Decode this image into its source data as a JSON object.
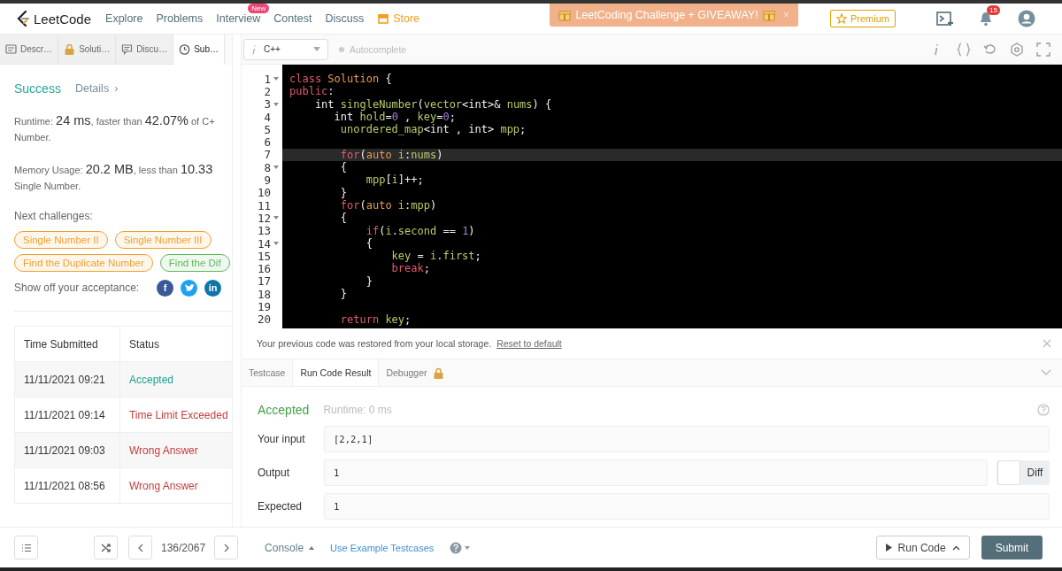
{
  "nav": {
    "logo": "LeetCode",
    "items": [
      {
        "label": "Explore",
        "kind": "link"
      },
      {
        "label": "Problems",
        "kind": "link"
      },
      {
        "label": "Interview",
        "kind": "link",
        "badge": "New"
      },
      {
        "label": "Contest",
        "kind": "link"
      },
      {
        "label": "Discuss",
        "kind": "link"
      },
      {
        "label": "Store",
        "kind": "store"
      }
    ],
    "banner": {
      "text": "LeetCoding Challenge + GIVEAWAY!",
      "close": "×"
    },
    "premium": "Premium",
    "notifications": "15"
  },
  "left_tabs": [
    {
      "label": "Descr…",
      "kind": "description",
      "selected": false
    },
    {
      "label": "Soluti…",
      "kind": "lock",
      "selected": false
    },
    {
      "label": "Discu…",
      "kind": "comment",
      "selected": false
    },
    {
      "label": "Sub…",
      "kind": "clock",
      "selected": true
    }
  ],
  "result": {
    "status": "Success",
    "details": "Details",
    "details_chevron": "›",
    "runtime": [
      [
        {
          "text": "Runtime: ",
          "kind": "label"
        },
        {
          "text": "24 ms",
          "kind": "big"
        },
        {
          "text": ", faster than ",
          "kind": "label"
        },
        {
          "text": "42.07%",
          "kind": "big"
        },
        {
          "text": " of C+",
          "kind": "label"
        }
      ],
      [
        {
          "text": "Number.",
          "kind": "label"
        }
      ]
    ],
    "memory": [
      [
        {
          "text": "Memory Usage: ",
          "kind": "label"
        },
        {
          "text": "20.2 MB",
          "kind": "big"
        },
        {
          "text": ", less than ",
          "kind": "label"
        },
        {
          "text": "10.33",
          "kind": "big"
        }
      ],
      [
        {
          "text": "Single Number.",
          "kind": "label"
        }
      ]
    ],
    "next_label": "Next challenges:",
    "challenges": [
      {
        "label": "Single Number II",
        "color": "#f0a030"
      },
      {
        "label": "Single Number III",
        "color": "#f0a030"
      },
      {
        "label": "Find the Duplicate Number",
        "color": "#f0a030"
      },
      {
        "label": "Find the Dif",
        "color": "#5cb85c"
      }
    ],
    "share_label": "Show off your acceptance:",
    "share": [
      {
        "kind": "facebook",
        "glyph": "f"
      },
      {
        "kind": "twitter"
      },
      {
        "kind": "linkedin",
        "glyph": "in"
      }
    ]
  },
  "submissions": {
    "columns": [
      "Time Submitted",
      "Status"
    ],
    "rows": [
      {
        "time": "11/11/2021 09:21",
        "status": "Accepted",
        "color": "#1a9f8f"
      },
      {
        "time": "11/11/2021 09:14",
        "status": "Time Limit Exceeded",
        "color": "#c43b3b"
      },
      {
        "time": "11/11/2021 09:03",
        "status": "Wrong Answer",
        "color": "#c43b3b"
      },
      {
        "time": "11/11/2021 08:56",
        "status": "Wrong Answer",
        "color": "#c43b3b"
      }
    ]
  },
  "editor": {
    "language": "C++",
    "autocomplete": {
      "label": "Autocomplete",
      "on": false
    },
    "lines": [
      {
        "number": "1",
        "fold": true,
        "active": false,
        "tokens": [
          {
            "text": "class ",
            "kind": "kw"
          },
          {
            "text": "Solution",
            "kind": "cls"
          },
          {
            "text": " {",
            "kind": "p"
          }
        ]
      },
      {
        "number": "2",
        "fold": false,
        "active": false,
        "tokens": [
          {
            "text": "public",
            "kind": "kw"
          },
          {
            "text": ":",
            "kind": "p"
          }
        ]
      },
      {
        "number": "3",
        "fold": true,
        "active": false,
        "tokens": [
          {
            "text": "    int ",
            "kind": "p"
          },
          {
            "text": "singleNumber",
            "kind": "fn"
          },
          {
            "text": "(",
            "kind": "p"
          },
          {
            "text": "vector",
            "kind": "fn"
          },
          {
            "text": "<int>& ",
            "kind": "p"
          },
          {
            "text": "nums",
            "kind": "fn"
          },
          {
            "text": ") {",
            "kind": "p"
          }
        ]
      },
      {
        "number": "4",
        "fold": false,
        "active": false,
        "tokens": [
          {
            "text": "       int ",
            "kind": "p"
          },
          {
            "text": "hold",
            "kind": "fn"
          },
          {
            "text": "=",
            "kind": "p"
          },
          {
            "text": "0",
            "kind": "num"
          },
          {
            "text": " , ",
            "kind": "p"
          },
          {
            "text": "key",
            "kind": "fn"
          },
          {
            "text": "=",
            "kind": "p"
          },
          {
            "text": "0",
            "kind": "num"
          },
          {
            "text": ";",
            "kind": "p"
          }
        ]
      },
      {
        "number": "5",
        "fold": false,
        "active": false,
        "tokens": [
          {
            "text": "        unordered_map",
            "kind": "fn"
          },
          {
            "text": "<int , int> ",
            "kind": "p"
          },
          {
            "text": "mpp",
            "kind": "fn"
          },
          {
            "text": ";",
            "kind": "p"
          }
        ]
      },
      {
        "number": "6",
        "fold": false,
        "active": false
      },
      {
        "number": "7",
        "fold": false,
        "active": true,
        "tokens": [
          {
            "text": "        for",
            "kind": "kw"
          },
          {
            "text": "(",
            "kind": "p"
          },
          {
            "text": "auto ",
            "kind": "cls"
          },
          {
            "text": "i",
            "kind": "fn"
          },
          {
            "text": ":",
            "kind": "p"
          },
          {
            "text": "nums",
            "kind": "fn"
          },
          {
            "text": ")",
            "kind": "p"
          }
        ]
      },
      {
        "number": "8",
        "fold": true,
        "active": false,
        "tokens": [
          {
            "text": "        {",
            "kind": "p"
          }
        ]
      },
      {
        "number": "9",
        "fold": false,
        "active": false,
        "tokens": [
          {
            "text": "            mpp",
            "kind": "fn"
          },
          {
            "text": "[",
            "kind": "p"
          },
          {
            "text": "i",
            "kind": "fn"
          },
          {
            "text": "]++;",
            "kind": "p"
          }
        ]
      },
      {
        "number": "10",
        "fold": false,
        "active": false,
        "tokens": [
          {
            "text": "        }",
            "kind": "p"
          }
        ]
      },
      {
        "number": "11",
        "fold": false,
        "active": false,
        "tokens": [
          {
            "text": "        for",
            "kind": "kw"
          },
          {
            "text": "(",
            "kind": "p"
          },
          {
            "text": "auto ",
            "kind": "cls"
          },
          {
            "text": "i",
            "kind": "fn"
          },
          {
            "text": ":",
            "kind": "p"
          },
          {
            "text": "mpp",
            "kind": "fn"
          },
          {
            "text": ")",
            "kind": "p"
          }
        ]
      },
      {
        "number": "12",
        "fold": true,
        "active": false,
        "tokens": [
          {
            "text": "        {",
            "kind": "p"
          }
        ]
      },
      {
        "number": "13",
        "fold": false,
        "active": false,
        "tokens": [
          {
            "text": "            if",
            "kind": "kw"
          },
          {
            "text": "(",
            "kind": "p"
          },
          {
            "text": "i",
            "kind": "fn"
          },
          {
            "text": ".",
            "kind": "p"
          },
          {
            "text": "second",
            "kind": "fn"
          },
          {
            "text": " == ",
            "kind": "p"
          },
          {
            "text": "1",
            "kind": "num"
          },
          {
            "text": ")",
            "kind": "p"
          }
        ]
      },
      {
        "number": "14",
        "fold": true,
        "active": false,
        "tokens": [
          {
            "text": "            {",
            "kind": "p"
          }
        ]
      },
      {
        "number": "15",
        "fold": false,
        "active": false,
        "tokens": [
          {
            "text": "                key",
            "kind": "fn"
          },
          {
            "text": " = ",
            "kind": "p"
          },
          {
            "text": "i",
            "kind": "fn"
          },
          {
            "text": ".",
            "kind": "p"
          },
          {
            "text": "first",
            "kind": "fn"
          },
          {
            "text": ";",
            "kind": "p"
          }
        ]
      },
      {
        "number": "16",
        "fold": false,
        "active": false,
        "tokens": [
          {
            "text": "                break",
            "kind": "kw"
          },
          {
            "text": ";",
            "kind": "p"
          }
        ]
      },
      {
        "number": "17",
        "fold": false,
        "active": false,
        "tokens": [
          {
            "text": "            }",
            "kind": "p"
          }
        ]
      },
      {
        "number": "18",
        "fold": false,
        "active": false,
        "tokens": [
          {
            "text": "        }",
            "kind": "p"
          }
        ]
      },
      {
        "number": "19",
        "fold": false,
        "active": false
      },
      {
        "number": "20",
        "fold": false,
        "active": false,
        "tokens": [
          {
            "text": "        return ",
            "kind": "kw"
          },
          {
            "text": "key",
            "kind": "fn"
          },
          {
            "text": ";",
            "kind": "p"
          }
        ]
      }
    ]
  },
  "notice": {
    "text": "Your previous code was restored from your local storage.",
    "link": "Reset to default"
  },
  "console_tabs": [
    {
      "label": "Testcase",
      "selected": false,
      "locked": false
    },
    {
      "label": "Run Code Result",
      "selected": true,
      "locked": false
    },
    {
      "label": "Debugger",
      "selected": false,
      "locked": true
    }
  ],
  "run_result": {
    "status": "Accepted",
    "runtime": "Runtime: 0 ms",
    "fields": [
      {
        "label": "Your input",
        "value": "[2,2,1]"
      },
      {
        "label": "Output",
        "value": "1",
        "diff": {
          "label": "Diff",
          "on": false
        }
      },
      {
        "label": "Expected",
        "value": "1"
      }
    ]
  },
  "footer": {
    "page": "136/2067",
    "console": "Console",
    "example": "Use Example Testcases",
    "run": "Run Code",
    "submit": "Submit"
  }
}
